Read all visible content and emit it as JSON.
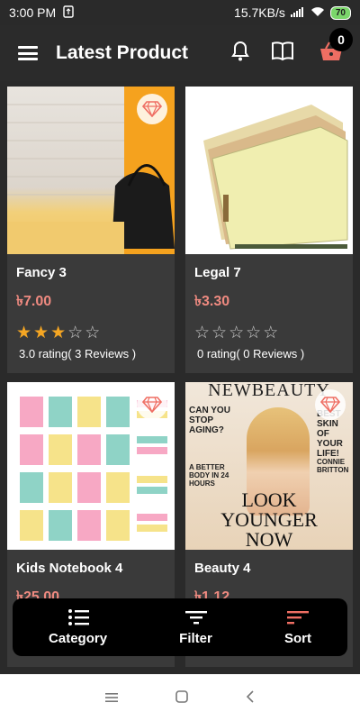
{
  "status": {
    "time": "3:00 PM",
    "speed": "15.7KB/s",
    "battery": "70"
  },
  "appbar": {
    "title": "Latest Product",
    "cart_count": "0"
  },
  "products": [
    {
      "name": "Fancy 3",
      "price": "৳7.00",
      "rating": 3,
      "rating_text": "3.0 rating( 3 Reviews )"
    },
    {
      "name": "Legal 7",
      "price": "৳3.30",
      "rating": 0,
      "rating_text": "0 rating( 0 Reviews )"
    },
    {
      "name": "Kids Notebook 4",
      "price": "৳25.00"
    },
    {
      "name": "Beauty 4",
      "price": "৳1.12"
    }
  ],
  "magazine": {
    "brand": "NEWBEAUTY",
    "headline1": "CAN YOU STOP AGING?",
    "headline2": "BEST SKIN OF YOUR LIFE!",
    "headline3": "LOOK YOUNGER NOW",
    "headline4": "A BETTER BODY IN 24 HOURS",
    "headline5": "CONNIE BRITTON"
  },
  "actions": {
    "category": "Category",
    "filter": "Filter",
    "sort": "Sort"
  },
  "colors": {
    "price": "#ef8a80",
    "star": "#f5a623",
    "sort_accent": "#ef6e63"
  }
}
